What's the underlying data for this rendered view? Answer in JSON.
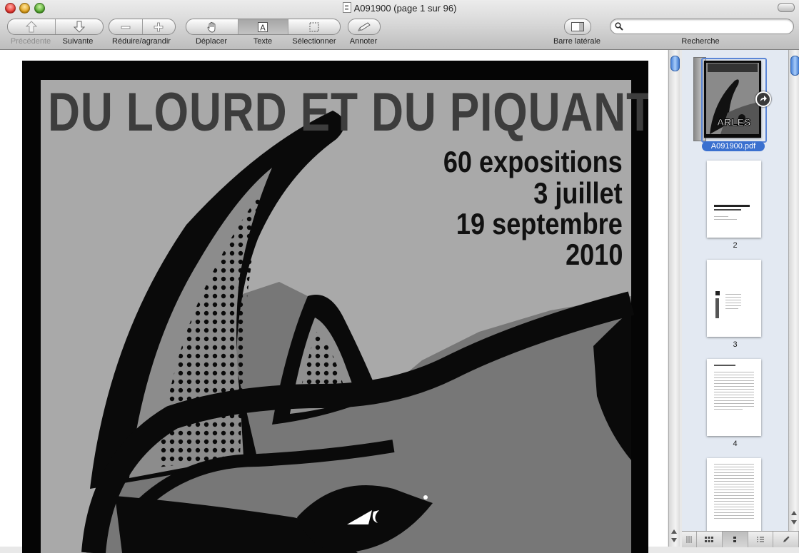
{
  "window": {
    "title": "A091900 (page 1 sur 96)"
  },
  "toolbar": {
    "prev_label": "Précédente",
    "next_label": "Suivante",
    "zoom_label": "Réduire/agrandir",
    "move_label": "Déplacer",
    "text_label": "Texte",
    "select_label": "Sélectionner",
    "annotate_label": "Annoter",
    "sidebar_label": "Barre latérale",
    "search_label": "Recherche",
    "search_value": ""
  },
  "poster": {
    "title": "DU LOURD ET DU PIQUANT",
    "line1": "60 expositions",
    "line2": "3 juillet",
    "line3": "19 septembre",
    "line4": "2010",
    "thumb_brand": "ARLES"
  },
  "sidebar": {
    "selected_file": "A091900.pdf",
    "pages": [
      "2",
      "3",
      "4"
    ]
  },
  "colors": {
    "selection": "#3a70cf",
    "sidebar_bg": "#e3e9f2",
    "scroll_thumb": "#6fa1ea"
  }
}
